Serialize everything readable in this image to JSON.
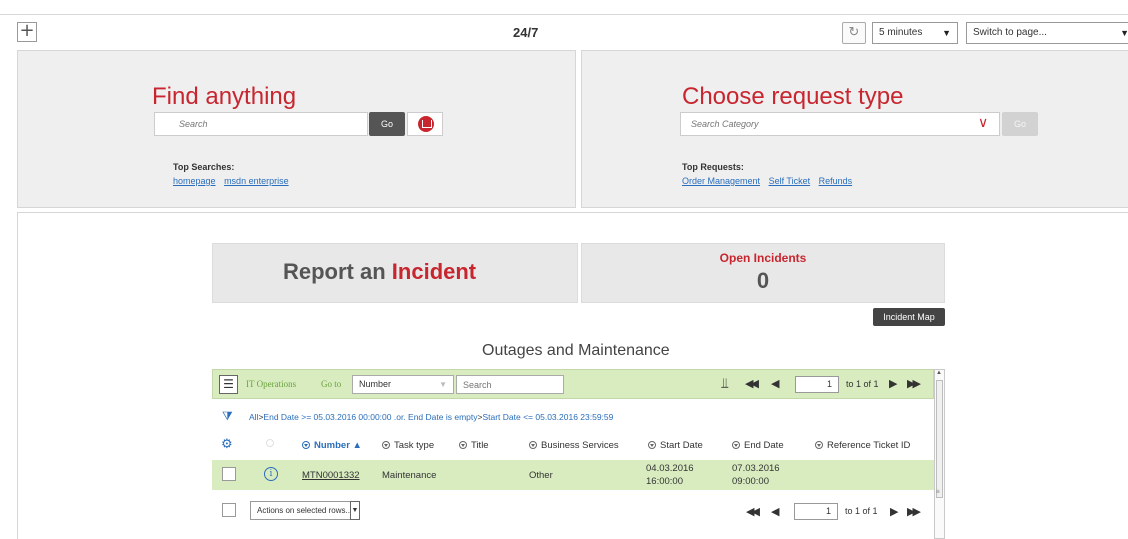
{
  "topbar": {
    "add_label": "+",
    "title": "24/7",
    "refresh_interval": "5 minutes",
    "switch_page": "Switch to page..."
  },
  "find_panel": {
    "title": "Find anything",
    "search_placeholder": "Search",
    "go_label": "Go",
    "top_label": "Top Searches:",
    "links": [
      "homepage",
      "msdn enterprise"
    ]
  },
  "request_panel": {
    "title": "Choose request type",
    "search_placeholder": "Search Category",
    "go_label": "Go",
    "top_label": "Top Requests:",
    "links": [
      "Order Management",
      "Self Ticket",
      "Refunds"
    ]
  },
  "report": {
    "text_prefix": "Report an ",
    "text_highlight": "Incident"
  },
  "open_incidents": {
    "label": "Open Incidents",
    "count": "0",
    "map_button": "Incident Map"
  },
  "outages": {
    "title": "Outages and Maintenance",
    "list_title": "IT Operations",
    "goto_label": "Go to",
    "field_select": "Number",
    "search_placeholder": "Search",
    "page_value": "1",
    "page_of": "to 1 of 1",
    "filter": {
      "all": "All",
      "sep": ">",
      "cond1": "End Date >= 05.03.2016 00:00:00 .or. End Date is empty",
      "cond2": "Start Date <= 05.03.2016 23:59:59"
    },
    "columns": [
      "Number ▲",
      "Task type",
      "Title",
      "Business Services",
      "Start Date",
      "End Date",
      "Reference Ticket ID"
    ],
    "rows": [
      {
        "number": "MTN0001332",
        "task_type": "Maintenance",
        "title": "",
        "business_services": "Other",
        "start_date": "04.03.2016",
        "start_time": "16:00:00",
        "end_date": "07.03.2016",
        "end_time": "09:00:00",
        "reference_ticket_id": ""
      }
    ],
    "actions_label": "Actions on selected rows..."
  }
}
